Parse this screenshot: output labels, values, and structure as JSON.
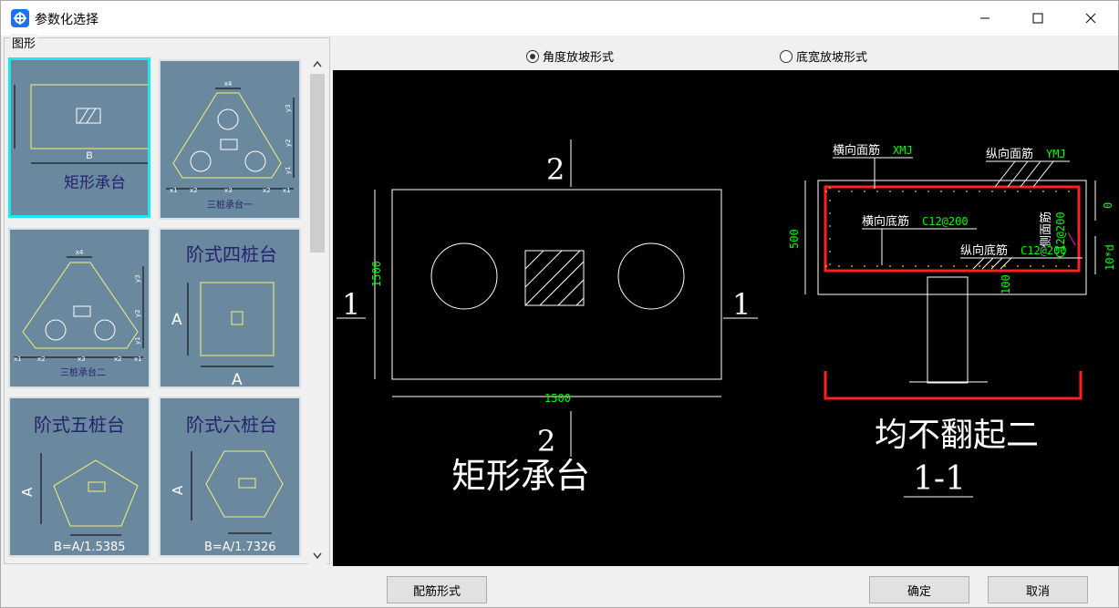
{
  "window": {
    "title": "参数化选择"
  },
  "left_panel": {
    "group_label": "图形",
    "thumbnails": [
      {
        "label": "矩形承台",
        "dim": "B",
        "selected": true
      },
      {
        "label": "三桩承台一",
        "dims": [
          "x4",
          "x1",
          "x2",
          "x3",
          "x2",
          "x1",
          "y3",
          "y2",
          "y1"
        ]
      },
      {
        "label": "三桩承台二",
        "dims": [
          "x4",
          "x1",
          "x2",
          "x3",
          "x2",
          "x1",
          "y3",
          "y2",
          "y1"
        ]
      },
      {
        "label": "阶式四桩台",
        "dims": [
          "A",
          "A"
        ]
      },
      {
        "label": "阶式五桩台",
        "dims": [
          "A"
        ],
        "formula": "B=A/1.5385"
      },
      {
        "label": "阶式六桩台",
        "dims": [
          "A"
        ],
        "formula": "B=A/1.7326"
      }
    ]
  },
  "options": {
    "radio_angle": "角度放坡形式",
    "radio_width": "底宽放坡形式",
    "selected": "angle"
  },
  "preview": {
    "plan_title": "矩形承台",
    "section_top": "2",
    "section_bottom": "2",
    "section_left": "1",
    "section_right": "1",
    "dim_width": "1500",
    "dim_height": "1500",
    "section_title": "均不翻起二",
    "section_name": "1-1",
    "lbl_top_transverse": "横向面筋",
    "val_top_transverse": "XMJ",
    "lbl_top_longitudinal": "纵向面筋",
    "val_top_longitudinal": "YMJ",
    "lbl_bottom_transverse": "横向底筋",
    "val_bottom_transverse": "C12@200",
    "lbl_bottom_longitudinal": "纵向底筋",
    "val_bottom_longitudinal": "C12@200",
    "lbl_side": "侧面筋",
    "val_side": "C12@200",
    "dim_depth": "500",
    "dim_cover_top": "0",
    "dim_anchor": "10*d",
    "dim_cover_bottom": "100",
    "colors": {
      "white": "#ffffff",
      "green": "#00ff00",
      "red": "#ff2020",
      "yellow": "#ffff00",
      "magenta": "#ff00ff"
    }
  },
  "buttons": {
    "rebar_form": "配筋形式",
    "ok": "确定",
    "cancel": "取消"
  }
}
